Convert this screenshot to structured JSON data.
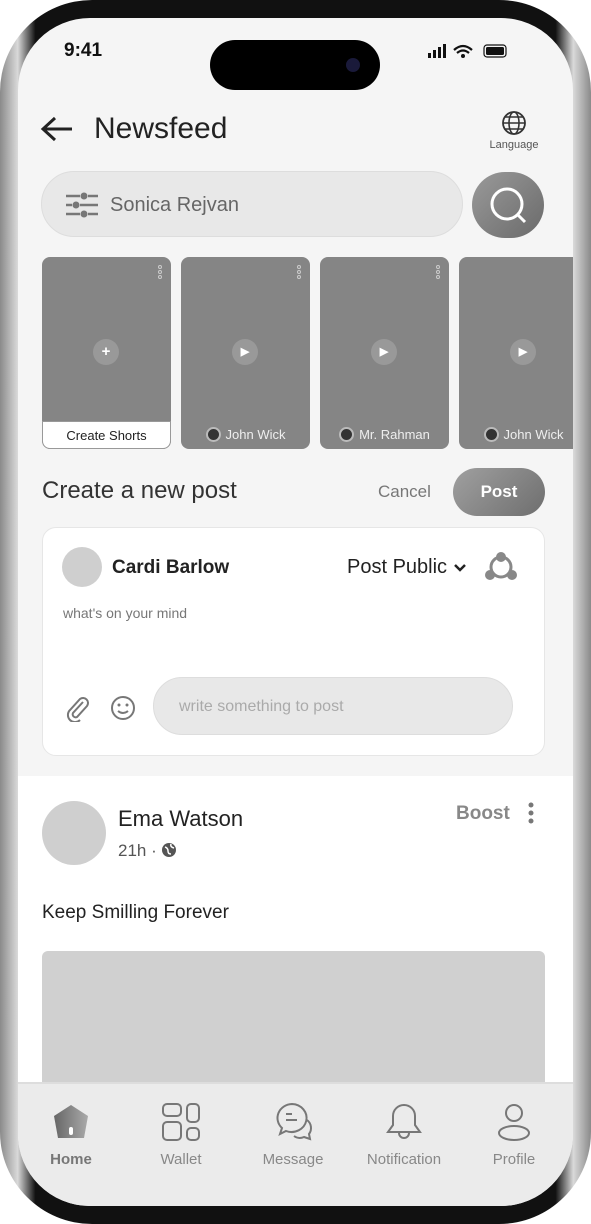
{
  "status": {
    "time": "9:41"
  },
  "header": {
    "title": "Newsfeed",
    "language_label": "Language"
  },
  "search": {
    "value": "Sonica Rejvan"
  },
  "shorts": [
    {
      "label": "Create Shorts",
      "type": "create"
    },
    {
      "label": "John Wick",
      "type": "video"
    },
    {
      "label": "Mr. Rahman",
      "type": "video"
    },
    {
      "label": "John Wick",
      "type": "video"
    }
  ],
  "create_post": {
    "title": "Create a new post",
    "cancel_label": "Cancel",
    "post_label": "Post",
    "user_name": "Cardi Barlow",
    "visibility": "Post Public",
    "prompt": "what's on your mind",
    "input_placeholder": "write something to post"
  },
  "feed_post": {
    "user_name": "Ema Watson",
    "time": "21h ·",
    "boost_label": "Boost",
    "text": "Keep Smilling Forever"
  },
  "nav": [
    {
      "label": "Home",
      "icon": "home-icon",
      "active": true
    },
    {
      "label": "Wallet",
      "icon": "wallet-icon"
    },
    {
      "label": "Message",
      "icon": "message-icon"
    },
    {
      "label": "Notification",
      "icon": "bell-icon"
    },
    {
      "label": "Profile",
      "icon": "profile-icon"
    }
  ]
}
